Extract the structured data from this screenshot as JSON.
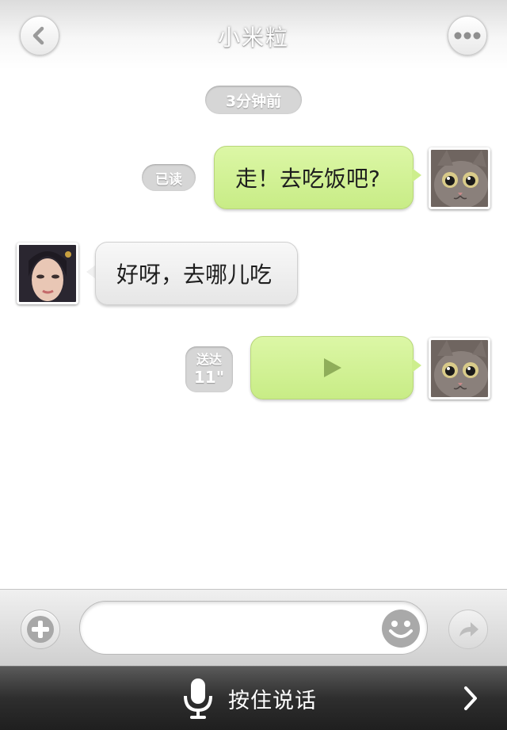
{
  "header": {
    "title": "小米粒",
    "back_icon": "chevron-left-icon",
    "more_icon": "more-dots-icon"
  },
  "time_separator": "3分钟前",
  "messages": [
    {
      "side": "right",
      "type": "text",
      "text": "走！去吃饭吧?",
      "status": "已读",
      "avatar": "cat-avatar"
    },
    {
      "side": "left",
      "type": "text",
      "text": "好呀，去哪儿吃",
      "avatar": "girl-avatar"
    },
    {
      "side": "right",
      "type": "voice",
      "status": "送达",
      "duration": "11\"",
      "avatar": "cat-avatar"
    }
  ],
  "input_bar": {
    "add_icon": "plus-icon",
    "message_input_value": "",
    "emoji_icon": "smiley-icon",
    "send_icon": "forward-arrow-icon"
  },
  "voice_bar": {
    "hold_to_talk_label": "按住说话",
    "mic_icon": "microphone-icon",
    "next_icon": "chevron-right-icon"
  },
  "colors": {
    "outgoing_bubble": "#cdee8d",
    "incoming_bubble": "#eeeeee",
    "badge": "#d6d6d6",
    "voice_bar": "#2e2e2e"
  }
}
